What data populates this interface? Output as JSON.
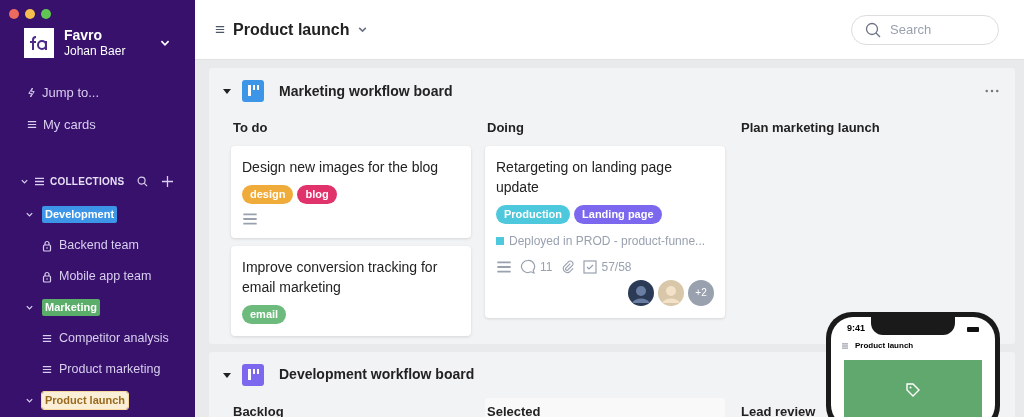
{
  "sidebar": {
    "workspace": "Favro",
    "user": "Johan Baer",
    "nav": [
      {
        "label": "Jump to...",
        "kind": "jump"
      },
      {
        "label": "My cards",
        "kind": "cards"
      }
    ],
    "collections_header": {
      "label": "COLLECTIONS",
      "expanded": true
    },
    "collections": [
      {
        "label": "Development",
        "color": "#3d95e8",
        "expanded": true,
        "selected": false,
        "children": [
          {
            "label": "Backend team",
            "kind": "private"
          },
          {
            "label": "Mobile app team",
            "kind": "private"
          }
        ]
      },
      {
        "label": "Marketing",
        "color": "#5aae6a",
        "expanded": true,
        "selected": false,
        "children": [
          {
            "label": "Competitor analysis",
            "kind": "board"
          },
          {
            "label": "Product marketing",
            "kind": "board"
          }
        ]
      },
      {
        "label": "Product launch",
        "color": "#fbeed6",
        "expanded": true,
        "selected": true
      }
    ]
  },
  "header": {
    "title": "Product launch",
    "search": {
      "placeholder": "Search"
    }
  },
  "boards": [
    {
      "title": "Marketing workflow board",
      "color": "#3d95e8",
      "expanded": true,
      "columns": [
        {
          "name": "To do",
          "highlighted": false,
          "cards": [
            {
              "title": "Design new images for the blog",
              "tags": [
                {
                  "label": "design",
                  "color": "#f0ac3a"
                },
                {
                  "label": "blog",
                  "color": "#e0336c"
                }
              ],
              "has_description": true
            },
            {
              "title": "Improve conversion tracking for email marketing",
              "tags": [
                {
                  "label": "email",
                  "color": "#6cba7c"
                }
              ],
              "has_description": false
            }
          ]
        },
        {
          "name": "Doing",
          "highlighted": false,
          "cards": [
            {
              "title": "Retargeting on landing page update",
              "tags": [
                {
                  "label": "Production",
                  "color": "#4ec8dc"
                },
                {
                  "label": "Landing page",
                  "color": "#7b68ee"
                }
              ],
              "has_description": true,
              "note": {
                "text": "Deployed in PROD - product-funne...",
                "color": "#4ec8dc"
              },
              "comments": "11",
              "attachments": true,
              "checklist": "57/58",
              "extra_members": "+2"
            }
          ]
        },
        {
          "name": "Plan marketing launch",
          "highlighted": false
        }
      ]
    },
    {
      "title": "Development workflow board",
      "color": "#7b68ee",
      "expanded": true,
      "columns": [
        {
          "name": "Backlog",
          "highlighted": false
        },
        {
          "name": "Selected",
          "highlighted": true
        },
        {
          "name": "Lead review",
          "highlighted": false
        }
      ]
    }
  ],
  "phone_preview": {
    "time": "9:41",
    "title": "Product launch"
  }
}
